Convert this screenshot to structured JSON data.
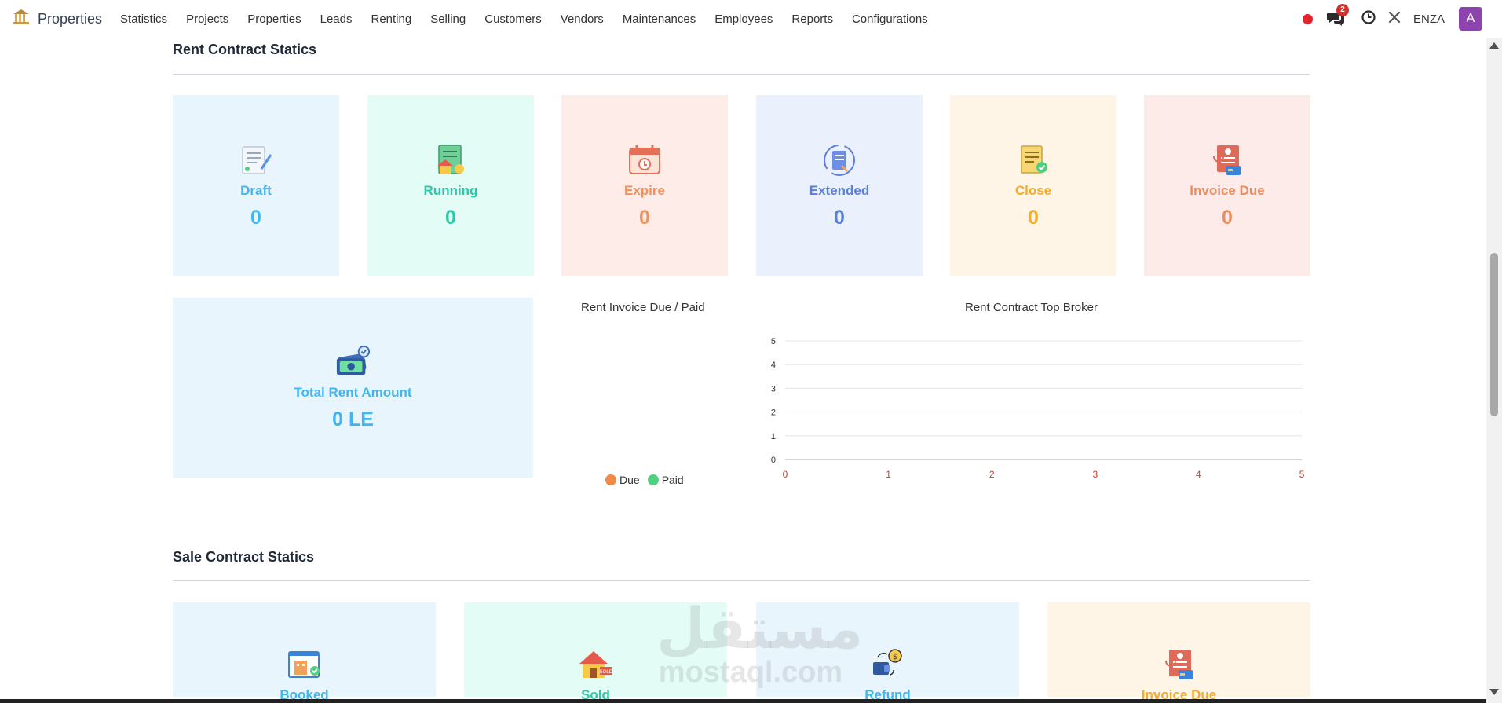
{
  "app": {
    "name": "Properties"
  },
  "menu": [
    "Statistics",
    "Projects",
    "Properties",
    "Leads",
    "Renting",
    "Selling",
    "Customers",
    "Vendors",
    "Maintenances",
    "Employees",
    "Reports",
    "Configurations"
  ],
  "systray": {
    "chat_count": "2",
    "company": "ENZA",
    "avatar_letter": "A"
  },
  "rent_section": {
    "title": "Rent Contract Statics",
    "cards": [
      {
        "label": "Draft",
        "value": "0",
        "icon": "draft-document-icon",
        "color": "#3fb6ef",
        "bg": "#e9f5fd"
      },
      {
        "label": "Running",
        "value": "0",
        "icon": "running-house-contract-icon",
        "color": "#2ec8a8",
        "bg": "#e3fcf6"
      },
      {
        "label": "Expire",
        "value": "0",
        "icon": "calendar-expire-icon",
        "color": "#f0905a",
        "bg": "#fdece7"
      },
      {
        "label": "Extended",
        "value": "0",
        "icon": "extended-contract-icon",
        "color": "#5c7fd8",
        "bg": "#eaf1fd"
      },
      {
        "label": "Close",
        "value": "0",
        "icon": "closed-contract-icon",
        "color": "#f5ac2b",
        "bg": "#fef5e7"
      },
      {
        "label": "Invoice Due",
        "value": "0",
        "icon": "invoice-due-icon",
        "color": "#ee8b5c",
        "bg": "#fcebe9"
      }
    ],
    "total": {
      "label": "Total Rent Amount",
      "value": "0 LE",
      "icon": "money-cash-icon",
      "color": "#3fb6ef",
      "bg": "#e9f5fd"
    }
  },
  "pie_chart": {
    "title": "Rent Invoice Due / Paid",
    "legend": [
      {
        "name": "Due",
        "color": "#ef8a48"
      },
      {
        "name": "Paid",
        "color": "#4fd081"
      }
    ]
  },
  "chart_data": {
    "type": "bar",
    "title": "Rent Contract Top Broker",
    "categories": [],
    "series": [],
    "xlim": [
      0,
      5
    ],
    "ylim": [
      0,
      5
    ],
    "x_ticks": [
      "0",
      "1",
      "2",
      "3",
      "4",
      "5"
    ],
    "y_ticks": [
      "0",
      "1",
      "2",
      "3",
      "4",
      "5"
    ],
    "x_tick_color": "#c9402d",
    "grid": true
  },
  "sale_section": {
    "title": "Sale Contract Statics",
    "cards": [
      {
        "label": "Booked",
        "icon": "booked-building-icon",
        "color": "#3fb6ef",
        "bg": "#e9f5fd"
      },
      {
        "label": "Sold",
        "icon": "sold-house-icon",
        "color": "#2ec8a8",
        "bg": "#e3fcf6"
      },
      {
        "label": "Refund",
        "icon": "refund-wallet-icon",
        "color": "#3fb6ef",
        "bg": "#e9f5fd"
      },
      {
        "label": "Invoice Due",
        "icon": "invoice-due-icon",
        "color": "#f5ac2b",
        "bg": "#fef5e7"
      }
    ]
  },
  "watermark": {
    "arabic": "مستقل",
    "latin": "mostaql.com"
  }
}
